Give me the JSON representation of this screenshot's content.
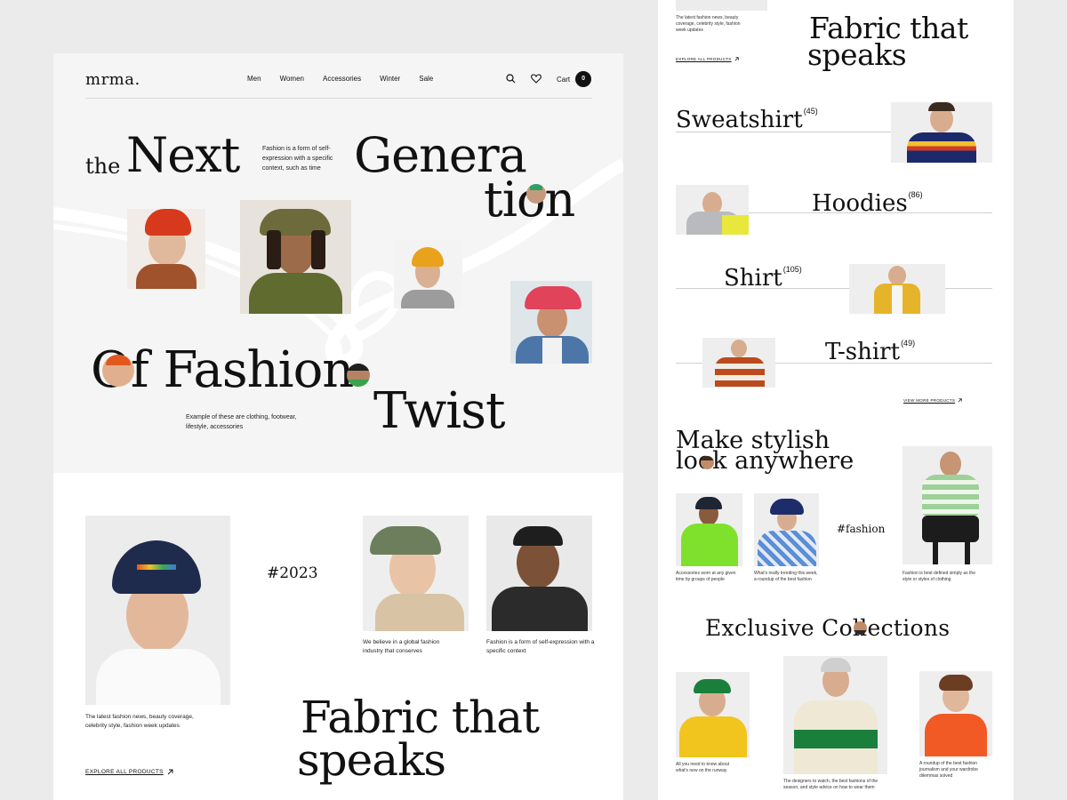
{
  "brand": "mrma.",
  "nav": {
    "items": [
      "Men",
      "Women",
      "Accessories",
      "Winter",
      "Sale"
    ],
    "cart_label": "Cart",
    "cart_count": "0"
  },
  "hero": {
    "the": "the",
    "next": "Next",
    "genera": "Genera",
    "tion": "tion",
    "blurb": "Fashion is a form of self-expression with a specific context, such as time",
    "of_fashion": "Of Fashion",
    "twist": "Twist",
    "example": "Example of these are clothing, footwear, lifestyle, accessories"
  },
  "section2": {
    "left_caption": "The latest fashion news, beauty coverage, celebrity style, fashion week updates",
    "explore": "EXPLORE ALL PRODUCTS",
    "tag": "#2023",
    "caption_a": "We believe in a global fashion industry that conserves",
    "caption_b": "Fashion is a form of self-expression with a specific context",
    "fabric_line1": "Fabric that",
    "fabric_line2": "speaks"
  },
  "right": {
    "top_caption": "The latest fashion news, beauty coverage, celebrity style, fashion week updates",
    "explore": "EXPLORE ALL PRODUCTS",
    "fabric_line1": "Fabric that",
    "fabric_line2": "speaks",
    "categories": [
      {
        "name": "Sweatshirt",
        "count": "(45)"
      },
      {
        "name": "Hoodies",
        "count": "(86)"
      },
      {
        "name": "Shirt",
        "count": "(105)"
      },
      {
        "name": "T-shirt",
        "count": "(49)"
      }
    ],
    "view_more": "VIEW MORE PRODUCTS",
    "stylish_line1": "Make stylish",
    "stylish_line2": "look anywhere",
    "hashtag": "#fashion",
    "cap1": "Accessories worn at any given time by groups of people",
    "cap2": "What's really trending this week, a roundup of the best fashion",
    "cap3": "Fashion is best defined simply as the style or styles of clothing",
    "exclusive": "Exclusive Collections",
    "ex_cap1": "All you need to know about what's new on the runway",
    "ex_cap2": "The designers to watch, the best fashions of the season, and style advice on how to wear them",
    "ex_cap3": "A roundup of the best fashion journalism and your wardrobe dilemmas solved"
  },
  "colors": {
    "background": "#ebebeb",
    "hero_bg": "#f5f5f5",
    "text": "#111111",
    "accent_orange": "#e2571d",
    "accent_green": "#5f6b2f"
  },
  "icons": [
    "search-icon",
    "heart-icon",
    "arrow-up-right-icon"
  ]
}
